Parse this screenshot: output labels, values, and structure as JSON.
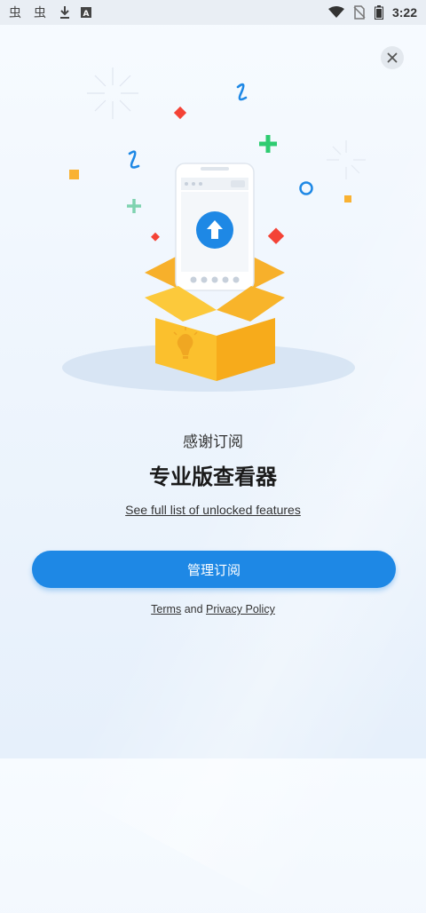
{
  "status_bar": {
    "time": "3:22",
    "left_icons": [
      "bug-icon",
      "bug-icon",
      "download-icon",
      "notification-a-icon"
    ],
    "right_icons": [
      "wifi-icon",
      "no-sim-icon",
      "battery-icon"
    ]
  },
  "close_icon": "close-icon",
  "texts": {
    "thanks": "感谢订阅",
    "plan_title": "专业版查看器",
    "features_link": "See full list of unlocked features"
  },
  "buttons": {
    "manage": "管理订阅"
  },
  "legal": {
    "terms": "Terms",
    "and": "and",
    "privacy": "Privacy Policy"
  },
  "colors": {
    "accent": "#1e88e5",
    "box": "#fbbf3a",
    "confetti_red": "#f44336",
    "confetti_green": "#2ecc71",
    "confetti_blue": "#1e88e5",
    "confetti_yellow": "#f9b233"
  }
}
